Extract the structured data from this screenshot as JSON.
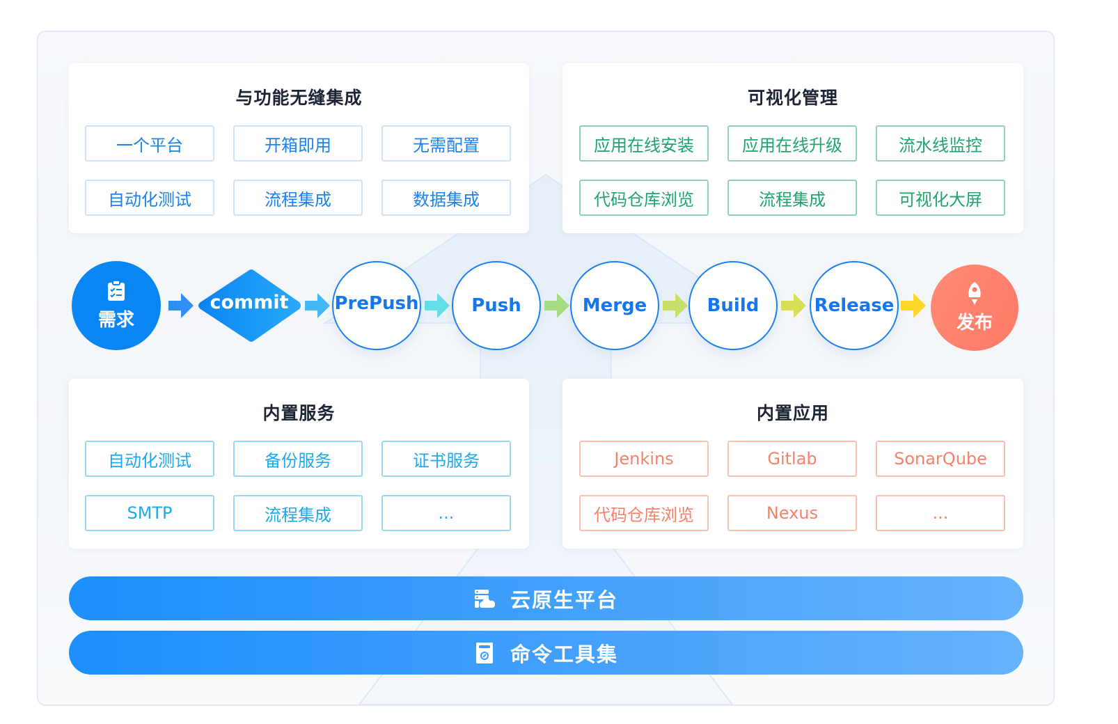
{
  "panels": {
    "integration": {
      "title": "与功能无缝集成",
      "items": [
        "一个平台",
        "开箱即用",
        "无需配置",
        "自动化测试",
        "流程集成",
        "数据集成"
      ]
    },
    "visual": {
      "title": "可视化管理",
      "items": [
        "应用在线安装",
        "应用在线升级",
        "流水线监控",
        "代码仓库浏览",
        "流程集成",
        "可视化大屏"
      ]
    },
    "services": {
      "title": "内置服务",
      "items": [
        "自动化测试",
        "备份服务",
        "证书服务",
        "SMTP",
        "流程集成",
        "..."
      ]
    },
    "apps": {
      "title": "内置应用",
      "items": [
        "Jenkins",
        "Gitlab",
        "SonarQube",
        "代码仓库浏览",
        "Nexus",
        "..."
      ]
    }
  },
  "flow": {
    "start": {
      "label": "需求",
      "icon": "clipboard-check-icon"
    },
    "commit": "commit",
    "steps": [
      "PrePush",
      "Push",
      "Merge",
      "Build",
      "Release"
    ],
    "end": {
      "label": "发布",
      "icon": "rocket-icon"
    },
    "arrow_colors": [
      "#2f8ff5",
      "#43b8f6",
      "#64dde9",
      "#a6dc83",
      "#c8e06a",
      "#d8df56",
      "#fcd62a"
    ]
  },
  "bars": [
    {
      "label": "云原生平台",
      "icon": "cloud-server-icon"
    },
    {
      "label": "命令工具集",
      "icon": "toolbox-icon"
    }
  ],
  "colors": {
    "primary": "#1a7ff0",
    "green": "#1fa56b",
    "cyan": "#1ea9ec",
    "salmon": "#f7806a",
    "end_node": "#fe7a66"
  }
}
